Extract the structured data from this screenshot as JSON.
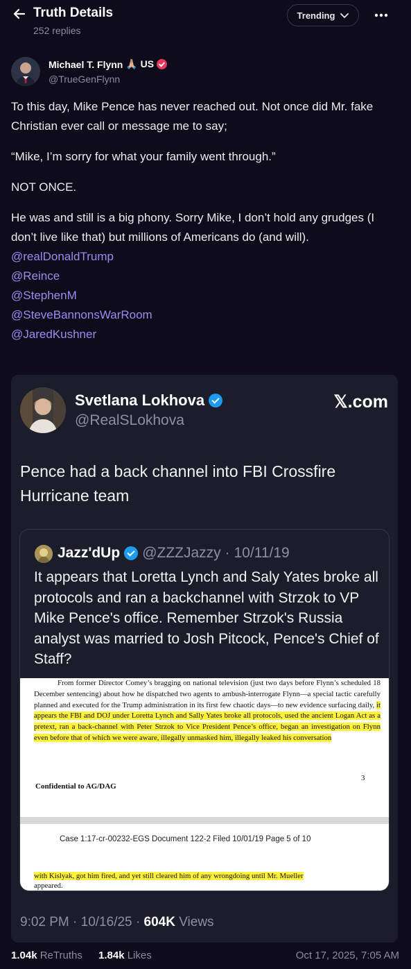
{
  "header": {
    "title": "Truth Details",
    "replies": "252 replies",
    "trending_label": "Trending"
  },
  "author": {
    "name": "Michael T. Flynn",
    "emoji": "🙏🏼 US",
    "handle": "@TrueGenFlynn"
  },
  "post": {
    "paragraphs": [
      "To this day, Mike Pence has never reached out. Not once did Mr. fake Christian ever call or message me to say;",
      "“Mike, I’m sorry for what your family went through.”",
      "NOT ONCE.",
      "He was and still is a big phony. Sorry Mike, I don’t hold any grudges (I don’t live like that) but millions of Americans do (and will)."
    ],
    "mentions": [
      "@realDonaldTrump",
      "@Reince",
      "@StephenM",
      "@SteveBannonsWarRoom",
      "@JaredKushner"
    ]
  },
  "embed": {
    "name": "Svetlana Lokhova",
    "handle": "@RealSLokhova",
    "source": "𝕏.com",
    "text": "Pence had a back channel into FBI Crossfire Hurricane team",
    "quote": {
      "name": "Jazz'dUp",
      "handle": "@ZZZJazzy",
      "date": "· 10/11/19",
      "text": "It appears that Loretta Lynch and Saly Yates broke all protocols and ran a backchannel with Strzok to VP Mike Pence's office. Remember Strzok's Russia analyst was married to Josh Pitcock, Pence's Chief of Staff?",
      "doc": {
        "plain": "From former Director Comey’s bragging on national television (just two days before Flynn’s scheduled 18 December sentencing) about how he dispatched two agents to ambush-interrogate Flynn—a special tactic carefully planned and executed for the Trump administration in its first few chaotic days—to new evidence surfacing daily, ",
        "highlight": "it appears the FBI and DOJ under Loretta Lynch and Sally Yates broke all protocols, used the ancient Logan Act as a pretext, ran a back-channel with Peter Strzok to Vice President Pence’s office, began an investigation on Flynn even before that of which we were aware, illegally unmasked him, illegally leaked his conversation",
        "page": "3",
        "confidential": "Confidential to AG/DAG",
        "case_line": "Case 1:17-cr-00232-EGS   Document 122-2   Filed 10/01/19   Page 5 of 10",
        "tail_highlight": "with Kislyak, got him fired, and yet still cleared him of any wrongdoing until Mr. Mueller",
        "tail_plain": "appeared."
      }
    },
    "footer_time": "9:02 PM · 10/16/25 · ",
    "footer_views_count": "604K",
    "footer_views_label": " Views"
  },
  "stats": {
    "retruths_count": "1.04k",
    "retruths_label": "ReTruths",
    "likes_count": "1.84k",
    "likes_label": "Likes",
    "date": "Oct 17, 2025, 7:05 AM"
  },
  "colors": {
    "background": "#0e0b1a",
    "mention": "#9a8df2",
    "card": "#1b1d2b",
    "verified_red": "#e8365d",
    "verified_blue": "#1d9bf0",
    "highlight": "#fff23a"
  },
  "icons": {
    "back": "arrow-left-icon",
    "trending_chevron": "chevron-down-icon",
    "more": "more-horizontal-icon"
  }
}
